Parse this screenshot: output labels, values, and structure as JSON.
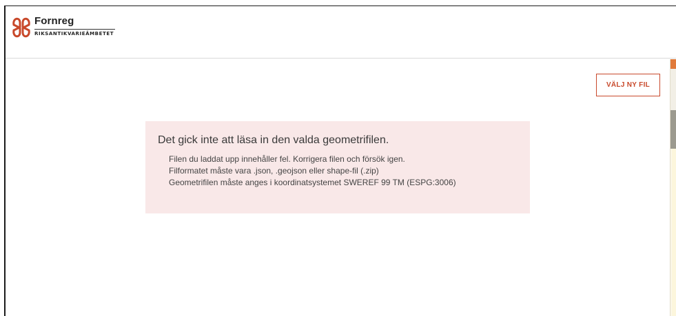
{
  "header": {
    "logo_title": "Fornreg",
    "logo_subtitle": "RIKSANTIKVARIEÄMBETET",
    "logo_icon": "riksantikvarieambetet-knot-icon",
    "brand_color": "#c8482a"
  },
  "toolbar": {
    "choose_new_file_label": "VÄLJ NY FIL"
  },
  "error": {
    "title": "Det gick inte att läsa in den valda geometrifilen.",
    "background_color": "#f9e8e8",
    "messages": [
      "Filen du laddat upp innehåller fel. Korrigera filen och försök igen.",
      "Filformatet måste vara .json, .geojson eller shape-fil (.zip)",
      "Geometrifilen måste anges i koordinatsystemet SWEREF 99 TM (ESPG:3006)"
    ]
  }
}
